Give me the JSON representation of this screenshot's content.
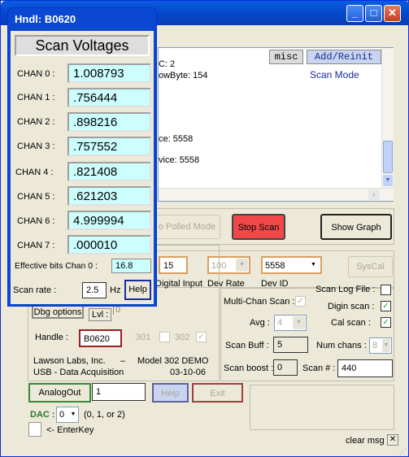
{
  "overlay": {
    "title": "Hndl: B0620",
    "header": "Scan Voltages",
    "channels": [
      {
        "label": "CHAN 0 :",
        "value": "1.008793"
      },
      {
        "label": "CHAN 1 :",
        "value": ".756444"
      },
      {
        "label": "CHAN 2 :",
        "value": ".898216"
      },
      {
        "label": "CHAN 3 :",
        "value": ".757552"
      },
      {
        "label": "CHAN 4 :",
        "value": ".821408"
      },
      {
        "label": "CHAN 5 :",
        "value": ".621203"
      },
      {
        "label": "CHAN 6 :",
        "value": "4.999994"
      },
      {
        "label": "CHAN 7 :",
        "value": ".000010"
      }
    ],
    "effective_bits_label": "Effective bits  Chan 0 :",
    "effective_bits_value": "16.8",
    "scan_rate_label": "Scan rate :",
    "scan_rate_value": "2.5",
    "hz_label": "Hz",
    "help_label": "Help"
  },
  "main": {
    "misc_label": "misc",
    "add_reinit_label": "Add/Reinit",
    "scan_mode_label": "Scan Mode",
    "info_lines": [
      "C: 2",
      "owByte: 154",
      "ce: 5558",
      "vice: 5558"
    ],
    "polled_mode_label": "o Polled Mode",
    "stop_scan_label": "Stop Scan",
    "show_graph_label": "Show Graph",
    "digital_input_value": "15",
    "digital_input_label": "Digital Input",
    "dev_rate_value": "100",
    "dev_rate_label": "Dev Rate",
    "dev_id_value": "5558",
    "dev_id_label": "Dev ID",
    "syscal_label": "SysCal",
    "dbg_options_label": "Dbg options",
    "lvl_label": "Lvl :",
    "lvl_value": "0",
    "handle_label": "Handle :",
    "handle_value": "B0620",
    "model_301_label": "301",
    "model_302_label": "302",
    "company_line1": "Lawson Labs, Inc.",
    "company_dash": "–",
    "company_line2": "USB - Data Acquisition",
    "model_line1": "Model 302 DEMO",
    "model_line2": "03-10-06",
    "multi_chan_label": "Multi-Chan Scan :",
    "avg_label": "Avg :",
    "avg_value": "4",
    "scan_buff_label": "Scan  Buff :",
    "scan_buff_value": "5",
    "scan_boost_label": "Scan boost :",
    "scan_boost_value": "0",
    "scan_log_label": "Scan Log File :",
    "digin_scan_label": "Digin scan :",
    "cal_scan_label": "Cal scan :",
    "num_chans_label": "Num chans :",
    "num_chans_value": "8",
    "scan_num_label": "Scan # :",
    "scan_num_value": "440",
    "analog_out_label": "AnalogOut",
    "analog_out_value": "1",
    "help_label": "Help",
    "exit_label": "Exit",
    "dac_label": "DAC :",
    "dac_value": "0",
    "dac_hint": "(0, 1, or 2)",
    "enterkey_label": "<- EnterKey",
    "clear_msg_label": "clear msg",
    "accent_colors": {
      "stop_scan": "#f04848",
      "cyan_field": "#ccfefe",
      "titlebar": "#0a48d2"
    }
  }
}
